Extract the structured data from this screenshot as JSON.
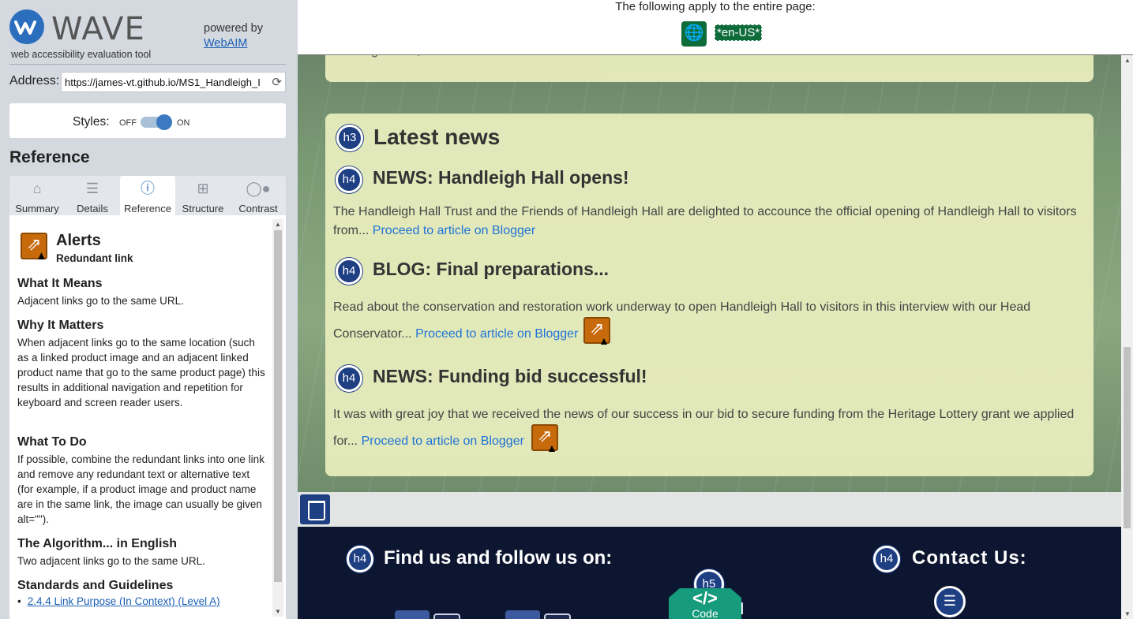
{
  "wave": {
    "logo_text": "WAVE",
    "tagline": "web accessibility evaluation tool",
    "powered_by": "powered by",
    "webaim_link": "WebAIM",
    "address_label": "Address:",
    "address_value": "https://james-vt.github.io/MS1_Handleigh_I",
    "styles_label": "Styles:",
    "styles_off": "OFF",
    "styles_on": "ON",
    "section_heading": "Reference",
    "tabs": [
      {
        "label": "Summary",
        "icon": "home-icon",
        "active": false
      },
      {
        "label": "Details",
        "icon": "list-icon",
        "active": false
      },
      {
        "label": "Reference",
        "icon": "info-icon",
        "active": true
      },
      {
        "label": "Structure",
        "icon": "structure-icon",
        "active": false
      },
      {
        "label": "Contrast",
        "icon": "contrast-icon",
        "active": false
      }
    ],
    "reference": {
      "category": "Alerts",
      "item": "Redundant link",
      "what_it_means_title": "What It Means",
      "what_it_means": "Adjacent links go to the same URL.",
      "why_it_matters_title": "Why It Matters",
      "why_it_matters": "When adjacent links go to the same location (such as a linked product image and an adjacent linked product name that go to the same product page) this results in additional navigation and repetition for keyboard and screen reader users.",
      "what_to_do_title": "What To Do",
      "what_to_do": "If possible, combine the redundant links into one link and remove any redundant text or alternative text (for example, if a product image and product name are in the same link, the image can usually be given alt=\"\").",
      "algorithm_title": "The Algorithm... in English",
      "algorithm": "Two adjacent links go to the same URL.",
      "standards_title": "Standards and Guidelines",
      "standards_link": "2.4.4 Link Purpose (In Context) (Level A)"
    }
  },
  "page": {
    "topbar_text": "The following apply to the entire page:",
    "lang_tag": "*en-US*",
    "top_card_text": "estate grounds, and a fabulous cafe.",
    "latest_news": {
      "badge": "h3",
      "title": "Latest news"
    },
    "articles": [
      {
        "badge": "h4",
        "title": "NEWS: Handleigh Hall opens!",
        "body": "The Handleigh Hall Trust and the Friends of Handleigh Hall are delighted to accounce the official opening of Handleigh Hall to visitors from...",
        "link": "Proceed to article on Blogger"
      },
      {
        "badge": "h4",
        "title": "BLOG: Final preparations...",
        "body": "Read about the conservation and restoration work underway to open Handleigh Hall to visitors in this interview with our Head Conservator...",
        "link": "Proceed to article on Blogger"
      },
      {
        "badge": "h4",
        "title": "NEWS: Funding bid successful!",
        "body": "It was with great joy that we received the news of our success in our bid to secure funding from the Heritage Lottery grant we applied for...",
        "link": "Proceed to article on Blogger"
      }
    ],
    "footer": {
      "find_us_badge": "h4",
      "find_us": "Find us and follow us on:",
      "h5_badge": "h5",
      "partial_heading": "d",
      "contact_badge": "h4",
      "contact": "Contact Us:",
      "code_symbol": "</>",
      "code_label": "Code"
    }
  }
}
